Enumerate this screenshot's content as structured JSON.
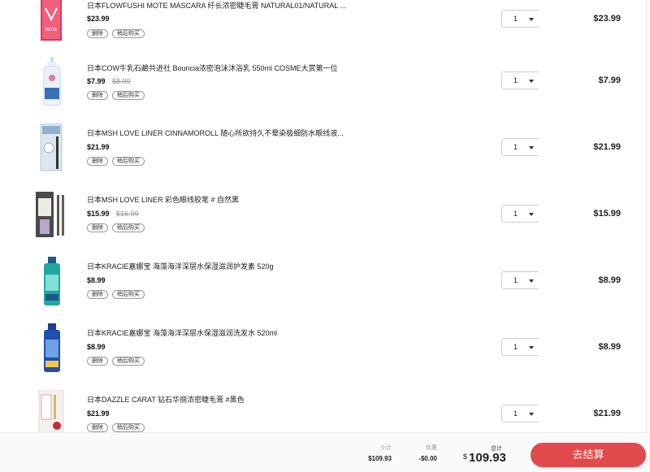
{
  "cart": {
    "delete_label": "删除",
    "save_label": "稍后购买",
    "items": [
      {
        "title": "日本FLOWFUSHI MOTE MASCARA 纤长浓密睫毛膏 NATURAL01/NATURAL ...",
        "price": "$23.99",
        "original_price": "",
        "quantity": "1",
        "line_total": "$23.99"
      },
      {
        "title": "日本COW牛乳石鹼共进社 Bouncia浓密泡沫沐浴乳 550ml COSME大赏第一位",
        "price": "$7.99",
        "original_price": "$8.99",
        "quantity": "1",
        "line_total": "$7.99"
      },
      {
        "title": "日本MSH LOVE LINER CINNAMOROLL 随心所欲持久不晕染极细防水眼线液...",
        "price": "$21.99",
        "original_price": "",
        "quantity": "1",
        "line_total": "$21.99"
      },
      {
        "title": "日本MSH LOVE LINER 彩色眼线胶笔 # 自然黑",
        "price": "$15.99",
        "original_price": "$16.99",
        "quantity": "1",
        "line_total": "$15.99"
      },
      {
        "title": "日本KRACIE嘉娜宝 海藻海洋深层水保湿滋润护发素 520g",
        "price": "$8.99",
        "original_price": "",
        "quantity": "1",
        "line_total": "$8.99"
      },
      {
        "title": "日本KRACIE嘉娜宝 海藻海洋深层水保湿滋润洗发水 520ml",
        "price": "$8.99",
        "original_price": "",
        "quantity": "1",
        "line_total": "$8.99"
      },
      {
        "title": "日本DAZZLE CARAT 钻石华丽浓密睫毛膏 #黑色",
        "price": "$21.99",
        "original_price": "",
        "quantity": "1",
        "line_total": "$21.99"
      }
    ]
  },
  "summary": {
    "subtotal_label": "小计",
    "subtotal_value": "$109.93",
    "discount_label": "优惠",
    "discount_value": "-$0.00",
    "total_label": "总计",
    "total_currency": "$",
    "total_value": "109.93",
    "checkout_label": "去结算"
  },
  "colors": {
    "checkout_button": "#e04a4d"
  }
}
